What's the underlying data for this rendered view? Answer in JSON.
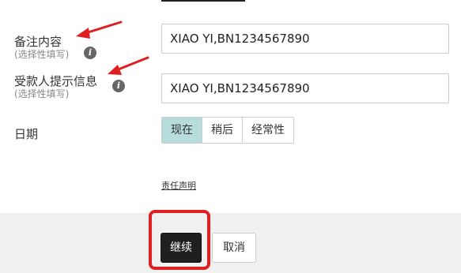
{
  "form": {
    "memo": {
      "label": "备注内容",
      "sublabel": "(选择性填写)",
      "value": "XIAO YI,BN1234567890"
    },
    "payee_hint": {
      "label": "受款人提示信息",
      "sublabel": "(选择性填写)",
      "value": "XIAO YI,BN1234567890"
    },
    "date": {
      "label": "日期",
      "options": [
        "现在",
        "稍后",
        "经常性"
      ],
      "selected": "现在"
    },
    "disclaimer": "责任声明"
  },
  "actions": {
    "continue": "继续",
    "cancel": "取消"
  },
  "icons": {
    "info": "info-icon",
    "annotation_arrow": "arrow-icon"
  },
  "colors": {
    "selected_segment": "#b7dcdc",
    "primary_button": "#1f1f1f",
    "annotation": "#e02020",
    "footer_background": "#f0f0f0"
  }
}
